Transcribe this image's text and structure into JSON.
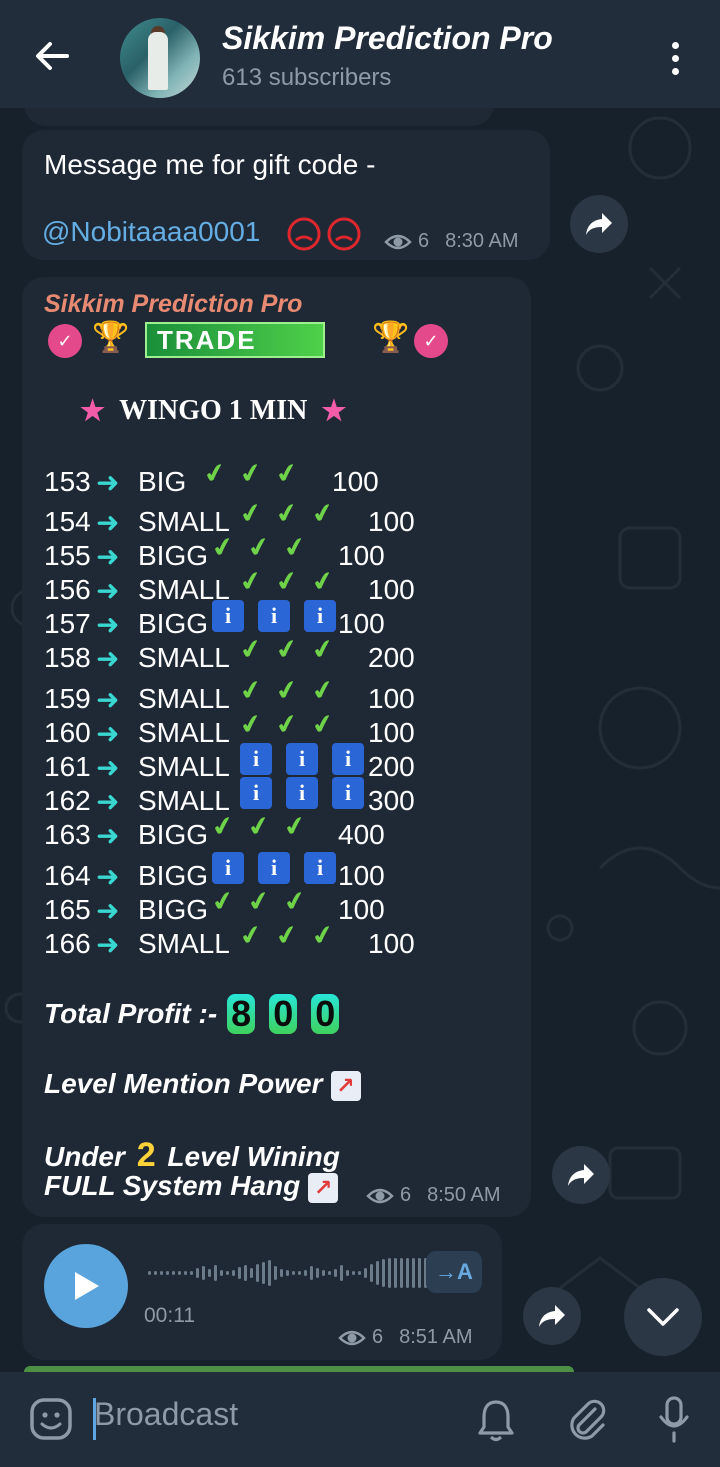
{
  "header": {
    "title": "Sikkim Prediction Pro",
    "subtitle": "613 subscribers"
  },
  "messages": {
    "gift": {
      "text": "Message me for gift code -",
      "username": "@Nobitaaaa0001",
      "views": "6",
      "time": "8:30 AM"
    },
    "prediction": {
      "signature": "Sikkim Prediction Pro",
      "trade_label": "TRADE",
      "heading": "WINGO 1 MIN",
      "rows": [
        {
          "period": "153",
          "result": "BIG",
          "marks": "check",
          "amount": "100"
        },
        {
          "period": "154",
          "result": "SMALL",
          "marks": "check",
          "amount": "100"
        },
        {
          "period": "155",
          "result": "BIGG",
          "marks": "check",
          "amount": "100"
        },
        {
          "period": "156",
          "result": "SMALL",
          "marks": "check",
          "amount": "100"
        },
        {
          "period": "157",
          "result": "BIGG",
          "marks": "info",
          "amount": "100"
        },
        {
          "period": "158",
          "result": "SMALL",
          "marks": "check",
          "amount": "200"
        },
        {
          "period": "159",
          "result": "SMALL",
          "marks": "check",
          "amount": "100"
        },
        {
          "period": "160",
          "result": "SMALL",
          "marks": "check",
          "amount": "100"
        },
        {
          "period": "161",
          "result": "SMALL",
          "marks": "info",
          "amount": "200"
        },
        {
          "period": "162",
          "result": "SMALL",
          "marks": "info",
          "amount": "300"
        },
        {
          "period": "163",
          "result": "BIGG",
          "marks": "check",
          "amount": "400"
        },
        {
          "period": "164",
          "result": "BIGG",
          "marks": "info",
          "amount": "100"
        },
        {
          "period": "165",
          "result": "BIGG",
          "marks": "check",
          "amount": "100"
        },
        {
          "period": "166",
          "result": "SMALL",
          "marks": "check",
          "amount": "100"
        }
      ],
      "total_label": "Total Profit :-",
      "total_digits": [
        "8",
        "0",
        "0"
      ],
      "level_mention": "Level Mention Power",
      "under_prefix": "Under",
      "under_number": "2",
      "under_suffix": "Level Wining",
      "full_system": "FULL System Hang",
      "views": "6",
      "time": "8:50 AM"
    },
    "voice": {
      "duration": "00:11",
      "transcribe_label": "→A",
      "views": "6",
      "time": "8:51 AM"
    }
  },
  "composer": {
    "placeholder": "Broadcast"
  },
  "icons": {
    "back": "back-arrow-icon",
    "menu": "more-vertical-icon",
    "forward": "share-forward-icon",
    "eye": "views-eye-icon",
    "emoji": "sticker-icon",
    "bell": "bell-icon",
    "attach": "paperclip-icon",
    "mic": "microphone-icon"
  },
  "colors": {
    "background": "#17212b",
    "header": "#212d3b",
    "bubble": "#1f2936",
    "link": "#65aee4",
    "signature": "#e88a72",
    "accent": "#5aa4dd"
  }
}
